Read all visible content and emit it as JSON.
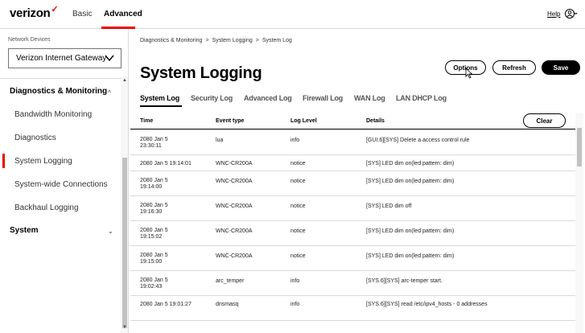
{
  "header": {
    "logo": "verizon",
    "tabs": [
      "Basic",
      "Advanced"
    ],
    "active_tab": "Advanced",
    "help": "Help"
  },
  "sidebar": {
    "device_label": "Network Devices",
    "device_selected": "Verizon Internet Gateway",
    "sections": [
      {
        "label": "Diagnostics & Monitoring",
        "items": [
          {
            "label": "Bandwidth Monitoring"
          },
          {
            "label": "Diagnostics"
          },
          {
            "label": "System Logging",
            "active": true
          },
          {
            "label": "System-wide Connections"
          },
          {
            "label": "Backhaul Logging"
          }
        ]
      },
      {
        "label": "System",
        "items": []
      }
    ]
  },
  "breadcrumb": [
    "Diagnostics & Monitoring",
    "System Logging",
    "System Log"
  ],
  "page": {
    "title": "System Logging",
    "buttons": {
      "options": "Options",
      "refresh": "Refresh",
      "save": "Save"
    }
  },
  "log_tabs": [
    "System Log",
    "Security Log",
    "Advanced Log",
    "Firewall Log",
    "WAN Log",
    "LAN DHCP Log"
  ],
  "active_log_tab": "System Log",
  "table": {
    "columns": [
      "Time",
      "Event type",
      "Log Level",
      "Details"
    ],
    "clear_label": "Clear",
    "rows": [
      {
        "time": [
          "2080 Jan 5",
          "23:30:11"
        ],
        "event": "lua",
        "level": "info",
        "details": "[GUI.6][SYS] Delete a access control rule"
      },
      {
        "time": [
          "2080 Jan 5 19:14:01"
        ],
        "event": "WNC-CR200A",
        "level": "notice",
        "details": "[SYS] LED dim on(led pattern: dim)"
      },
      {
        "time": [
          "2080 Jan 5",
          "19:14:00"
        ],
        "event": "WNC-CR200A",
        "level": "notice",
        "details": "[SYS] LED dim on(led pattern: dim)"
      },
      {
        "time": [
          "2080 Jan 5",
          "19:16:30"
        ],
        "event": "WNC-CR200A",
        "level": "notice",
        "details": "[SYS] LED dim off"
      },
      {
        "time": [
          "2080 Jan 5",
          "19:15:02"
        ],
        "event": "WNC-CR200A",
        "level": "notice",
        "details": "[SYS] LED dim on(led pattern: dim)"
      },
      {
        "time": [
          "2080 Jan 5",
          "19:15:00"
        ],
        "event": "WNC-CR200A",
        "level": "notice",
        "details": "[SYS] LED dim on(led pattern: dim)"
      },
      {
        "time": [
          "2080 Jan 5",
          "19:02:43"
        ],
        "event": "arc_temper",
        "level": "info",
        "details": "[SYS.6][SYS] arc-temper start."
      },
      {
        "time": [
          "2080 Jan 5 19:01:27"
        ],
        "event": "dnsmasq",
        "level": "info",
        "details": "[SYS.6][SYS] read /etc/ipv4_hosts - 0 addresses"
      }
    ]
  },
  "colors": {
    "accent": "#ee0000",
    "text": "#000000",
    "divider": "#d8dada"
  }
}
